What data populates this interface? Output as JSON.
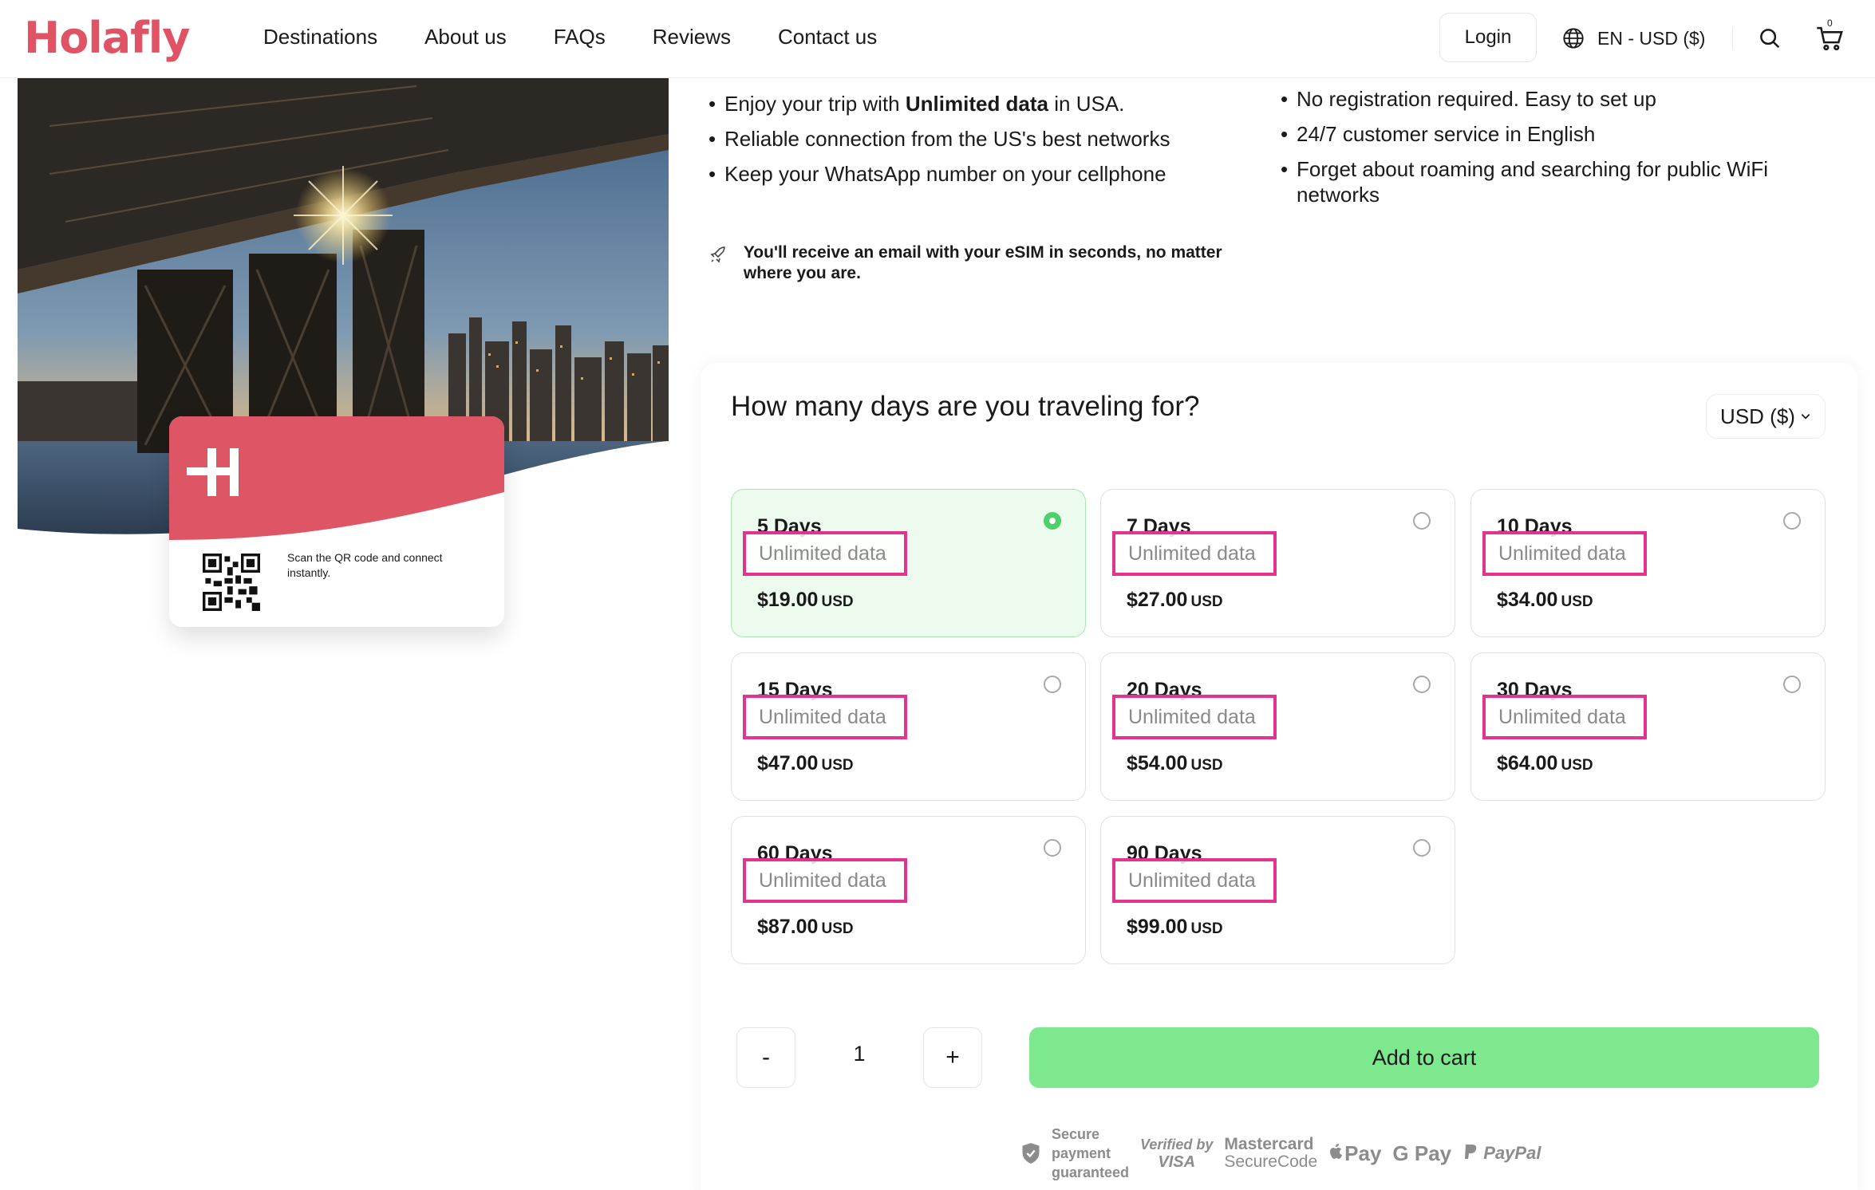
{
  "header": {
    "logo": "Holafly",
    "nav": [
      "Destinations",
      "About us",
      "FAQs",
      "Reviews",
      "Contact us"
    ],
    "login_label": "Login",
    "language": "EN - USD ($)",
    "cart_count": "0",
    "icons": [
      "globe-icon",
      "search-icon",
      "cart-icon"
    ]
  },
  "hero": {
    "sim_logo": "H",
    "sim_text": "Scan the QR code and connect instantly."
  },
  "features": {
    "left": [
      {
        "pre": "Enjoy your trip with ",
        "bold": "Unlimited data",
        "post": " in USA."
      },
      {
        "pre": "Reliable connection from the US's best networks",
        "bold": "",
        "post": ""
      },
      {
        "pre": "Keep your WhatsApp number on your cellphone",
        "bold": "",
        "post": ""
      }
    ],
    "right": [
      "No registration required. Easy to set up",
      "24/7 customer service in English",
      "Forget about roaming and searching for public WiFi networks"
    ],
    "email_note": "You'll receive an email with your eSIM in seconds, no matter where you are."
  },
  "plans_section": {
    "title": "How many days are you traveling for?",
    "currency": "USD ($)",
    "plans": [
      {
        "days": "5 Days",
        "data": "Unlimited data",
        "price": "$19.00",
        "currency": "USD",
        "selected": true
      },
      {
        "days": "7 Days",
        "data": "Unlimited data",
        "price": "$27.00",
        "currency": "USD",
        "selected": false
      },
      {
        "days": "10 Days",
        "data": "Unlimited data",
        "price": "$34.00",
        "currency": "USD",
        "selected": false
      },
      {
        "days": "15 Days",
        "data": "Unlimited data",
        "price": "$47.00",
        "currency": "USD",
        "selected": false
      },
      {
        "days": "20 Days",
        "data": "Unlimited data",
        "price": "$54.00",
        "currency": "USD",
        "selected": false
      },
      {
        "days": "30 Days",
        "data": "Unlimited data",
        "price": "$64.00",
        "currency": "USD",
        "selected": false
      },
      {
        "days": "60 Days",
        "data": "Unlimited data",
        "price": "$87.00",
        "currency": "USD",
        "selected": false
      },
      {
        "days": "90 Days",
        "data": "Unlimited data",
        "price": "$99.00",
        "currency": "USD",
        "selected": false
      }
    ]
  },
  "cart": {
    "minus_label": "-",
    "quantity": "1",
    "plus_label": "+",
    "add_label": "Add to cart"
  },
  "payments": {
    "secure_lines": [
      "Secure",
      "payment",
      "guaranteed"
    ],
    "verified_by": "Verified by",
    "visa": "VISA",
    "mastercard": "Mastercard",
    "securecode": "SecureCode",
    "apple_pay": "Pay",
    "google_pay": "G Pay",
    "paypal": "PayPal"
  },
  "colors": {
    "brand": "#e05365",
    "accent_green": "#7ee88f",
    "selected_bg": "#edfbef",
    "highlight_box": "#e4338f"
  }
}
